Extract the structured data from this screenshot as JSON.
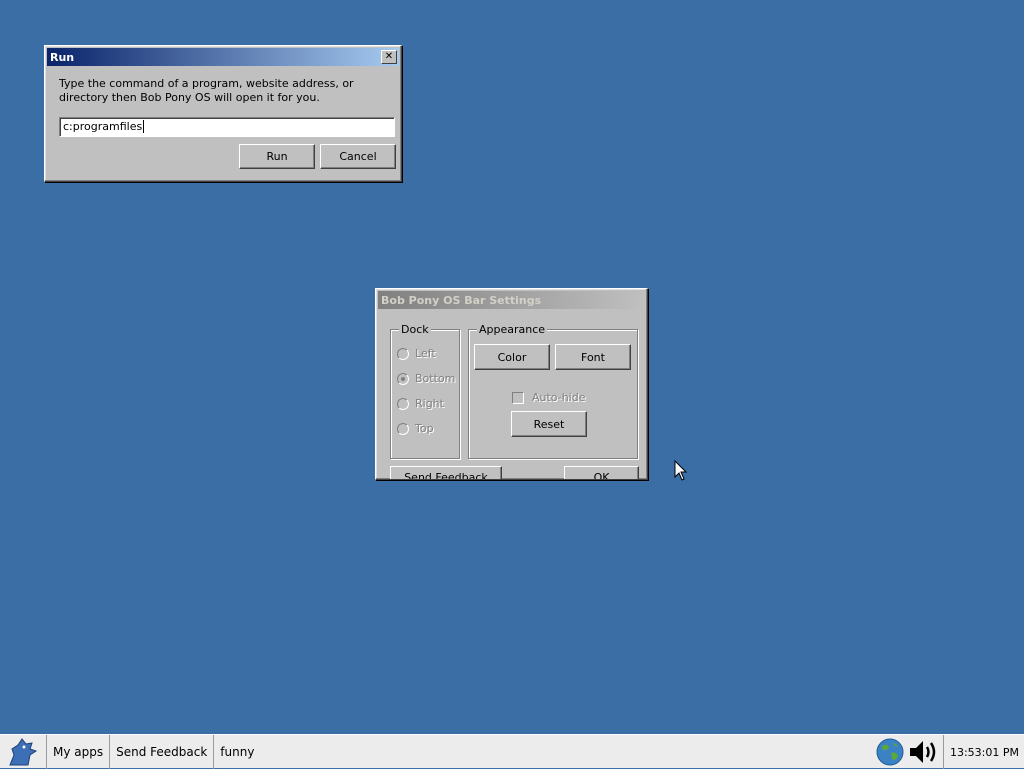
{
  "run_dialog": {
    "title": "Run",
    "description": "Type the command of a program, website address, or directory then Bob Pony OS will open it for you.",
    "command_value": "c:programfiles",
    "run_label": "Run",
    "cancel_label": "Cancel",
    "close_glyph": "✕"
  },
  "bar_settings": {
    "title": "Bob Pony OS Bar Settings",
    "dock": {
      "label": "Dock",
      "options": [
        {
          "label": "Left",
          "selected": false
        },
        {
          "label": "Bottom",
          "selected": true
        },
        {
          "label": "Right",
          "selected": false
        },
        {
          "label": "Top",
          "selected": false
        }
      ]
    },
    "appearance": {
      "label": "Appearance",
      "color_label": "Color",
      "font_label": "Font",
      "autohide_label": "Auto-hide",
      "autohide_checked": false,
      "reset_label": "Reset"
    },
    "send_feedback_label": "Send Feedback",
    "ok_label": "OK"
  },
  "taskbar": {
    "start_icon": "bob-pony-logo-icon",
    "items": [
      "My apps",
      "Send Feedback",
      "funny"
    ],
    "tray_icons": [
      "globe-icon",
      "speaker-icon"
    ],
    "clock": "13:53:01 PM"
  },
  "colors": {
    "desktop": "#3a6ea5",
    "window_face": "#c0c0c0",
    "active_title": "#0a246a",
    "taskbar": "#ececec"
  }
}
